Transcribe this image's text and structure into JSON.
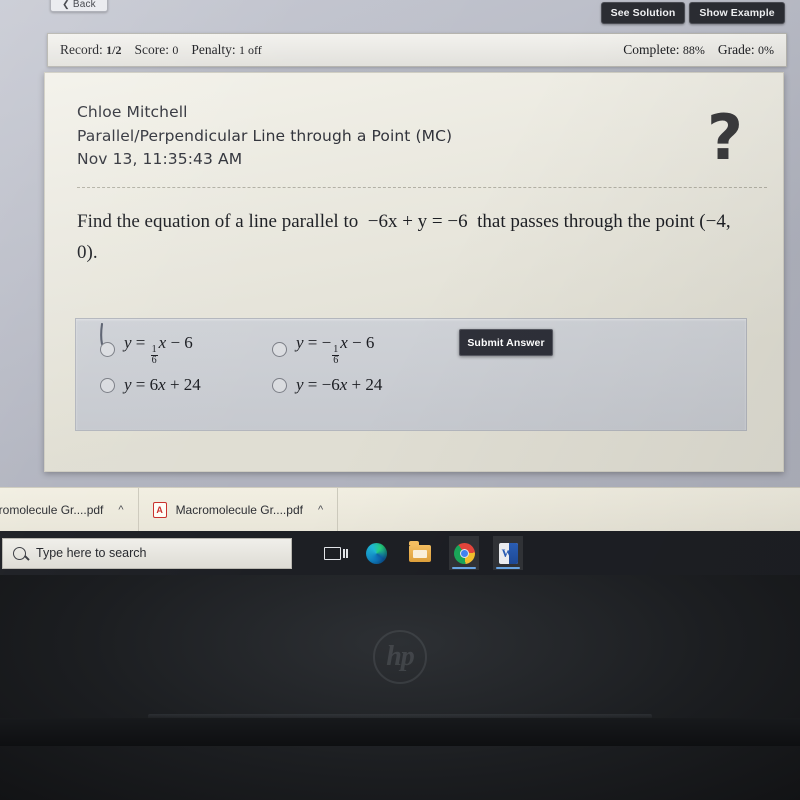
{
  "toolbar": {
    "back_label": "Back",
    "back_chevron": "chevron-left-icon",
    "see_solution_label": "See Solution",
    "show_example_label": "Show Example"
  },
  "status_bar": {
    "left": [
      {
        "label": "Record:",
        "value": "1/2"
      },
      {
        "label": "Score:",
        "value": "0"
      },
      {
        "label": "Penalty:",
        "value": "1 off"
      }
    ],
    "right": [
      {
        "label": "Complete:",
        "value": "88%"
      },
      {
        "label": "Grade:",
        "value": "0%"
      }
    ]
  },
  "question_card": {
    "student_name": "Chloe Mitchell",
    "assignment_title": "Parallel/Perpendicular Line through a Point (MC)",
    "timestamp": "Nov 13, 11:35:43 AM",
    "help_icon": "question-mark-icon",
    "question_parts": {
      "lead": "Find the equation of a line parallel to",
      "equation": "−6x + y = −6",
      "middle": "that passes through the point",
      "point": "(−4, 0)."
    }
  },
  "answers": {
    "options": [
      {
        "id": "a",
        "text": "y = ⅙x − 6",
        "selected": false
      },
      {
        "id": "b",
        "text": "y = −⅙x − 6",
        "selected": false
      },
      {
        "id": "c",
        "text": "y = 6x + 24",
        "selected": false
      },
      {
        "id": "d",
        "text": "y = −6x + 24",
        "selected": false
      }
    ],
    "submit_label": "Submit Answer"
  },
  "downloads": [
    {
      "name": "acromolecule Gr....pdf",
      "icon": "pdf-icon",
      "chevron": "chevron-up-icon"
    },
    {
      "name": "Macromolecule Gr....pdf",
      "icon": "pdf-icon",
      "chevron": "chevron-up-icon"
    }
  ],
  "taskbar": {
    "search_placeholder": "Type here to search",
    "search_icon": "search-icon",
    "icons": [
      {
        "name": "task-view-icon",
        "active": false
      },
      {
        "name": "edge-icon",
        "active": false
      },
      {
        "name": "file-explorer-icon",
        "active": false
      },
      {
        "name": "chrome-icon",
        "active": true
      },
      {
        "name": "word-icon",
        "active": true
      }
    ]
  },
  "device": {
    "brand_logo": "hp-logo",
    "brand_text": "hp"
  },
  "colors": {
    "dark_button": "#2b2d33",
    "card_bg": "#eceade",
    "answers_panel": "#cfd2d7",
    "taskbar": "#1d1f24",
    "pdf_red": "#c9302c"
  }
}
